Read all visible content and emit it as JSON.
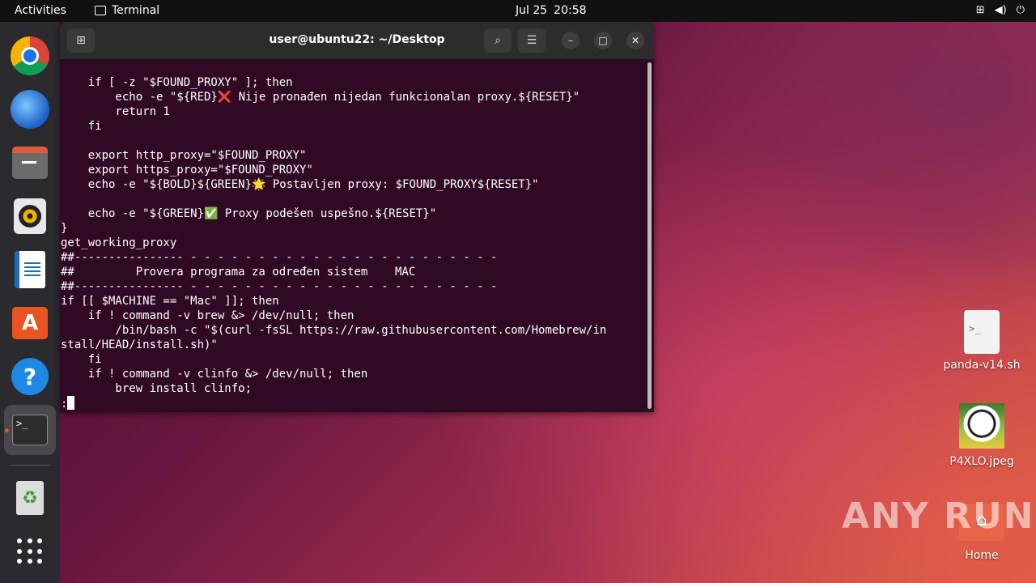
{
  "topbar": {
    "activities": "Activities",
    "app_name": "Terminal",
    "date": "Jul 25",
    "time": "20:58",
    "tray": [
      "network-icon",
      "volume-icon",
      "power-icon"
    ]
  },
  "dock": {
    "items": [
      "chrome-icon",
      "thunderbird-icon",
      "files-icon",
      "rhythmbox-icon",
      "writer-icon",
      "app-center-icon",
      "help-icon",
      "terminal-icon",
      "trash-icon",
      "show-apps-icon"
    ]
  },
  "terminal": {
    "title": "user@ubuntu22: ~/Desktop",
    "lines": [
      "    if [ -z \"$FOUND_PROXY\" ]; then",
      "        echo -e \"${RED}❌ Nije pronađen nijedan funkcionalan proxy.${RESET}\"",
      "        return 1",
      "    fi",
      "",
      "    export http_proxy=\"$FOUND_PROXY\"",
      "    export https_proxy=\"$FOUND_PROXY\"",
      "    echo -e \"${BOLD}${GREEN}🌟 Postavljen proxy: $FOUND_PROXY${RESET}\"",
      "",
      "    echo -e \"${GREEN}✅ Proxy podešen uspešno.${RESET}\"",
      "}",
      "get_working_proxy",
      "##---------------- - - - - - - - - - - - - - - - - - - - - - - -",
      "##         Provera programa za određen sistem    MAC",
      "##---------------- - - - - - - - - - - - - - - - - - - - - - - -",
      "if [[ $MACHINE == \"Mac\" ]]; then",
      "    if ! command -v brew &> /dev/null; then",
      "        /bin/bash -c \"$(curl -fsSL https://raw.githubusercontent.com/Homebrew/in",
      "stall/HEAD/install.sh)\"",
      "    fi",
      "    if ! command -v clinfo &> /dev/null; then",
      "        brew install clinfo;"
    ],
    "prompt": ":"
  },
  "desktop": {
    "icons": [
      {
        "label": "panda-v14.sh"
      },
      {
        "label": "P4XLO.jpeg"
      },
      {
        "label": "Home"
      }
    ]
  },
  "watermark": "ANY RUN"
}
